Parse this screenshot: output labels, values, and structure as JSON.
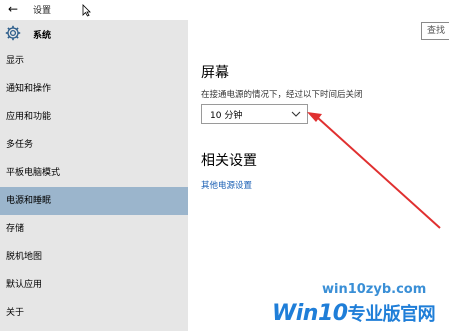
{
  "window": {
    "title": "设置"
  },
  "header": {
    "section": "系统",
    "search_placeholder": "查找"
  },
  "sidebar": {
    "items": [
      {
        "label": "显示"
      },
      {
        "label": "通知和操作"
      },
      {
        "label": "应用和功能"
      },
      {
        "label": "多任务"
      },
      {
        "label": "平板电脑模式"
      },
      {
        "label": "电源和睡眠",
        "active": true
      },
      {
        "label": "存储"
      },
      {
        "label": "脱机地图"
      },
      {
        "label": "默认应用"
      },
      {
        "label": "关于"
      }
    ]
  },
  "main": {
    "screen": {
      "title": "屏幕",
      "description": "在接通电源的情况下，经过以下时间后关闭",
      "selected_value": "10 分钟"
    },
    "related": {
      "title": "相关设置",
      "link": "其他电源设置"
    }
  },
  "watermark": {
    "url": "win10zyb.com",
    "brand": "Win10",
    "brand_cn": "专业版官网"
  },
  "colors": {
    "active_bg": "#9bb5cc",
    "sidebar_bg": "#e6e6e6",
    "link": "#1a5fb4",
    "arrow": "#e03030"
  }
}
